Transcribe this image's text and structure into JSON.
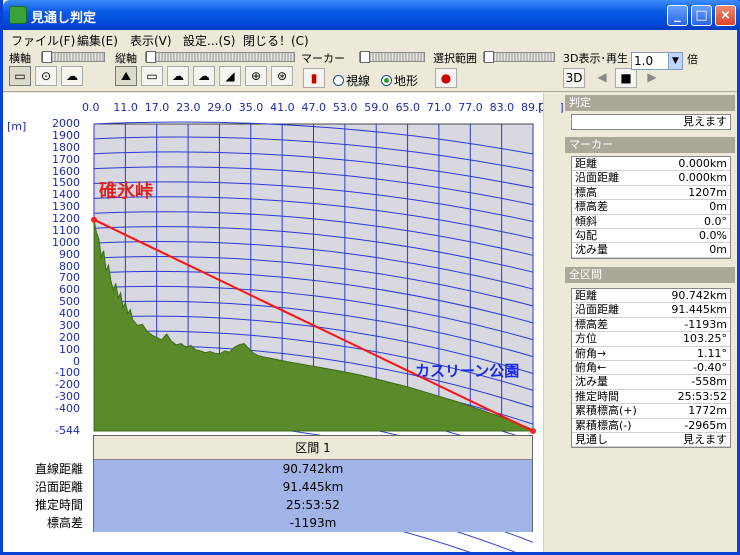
{
  "window": {
    "title": "見通し判定",
    "min": "_",
    "max": "□",
    "close": "×"
  },
  "menu": [
    "ファイル(F)",
    "編集(E)",
    "表示(V)",
    "設定...(S)",
    "閉じる！(C)"
  ],
  "toolbar": {
    "h_axis": "横軸",
    "v_axis": "縦軸",
    "marker": "マーカー",
    "range": "選択範囲",
    "view3d": "3D表示･再生",
    "zoom": "1.0",
    "times": "倍",
    "radio_sight": "視線",
    "radio_terrain": "地形",
    "radio_selected": "地形"
  },
  "chart_data": {
    "type": "area",
    "x_unit": "[km]",
    "y_unit": "[m]",
    "x_ticks": [
      "0.0",
      "11.0",
      "17.0",
      "23.0",
      "29.0",
      "35.0",
      "41.0",
      "47.0",
      "53.0",
      "59.0",
      "65.0",
      "71.0",
      "77.0",
      "83.0",
      "89.0"
    ],
    "y_ticks": [
      "2000",
      "1900",
      "1800",
      "1700",
      "1600",
      "1500",
      "1400",
      "1300",
      "1200",
      "1100",
      "1000",
      "900",
      "800",
      "700",
      "600",
      "500",
      "400",
      "300",
      "200",
      "100",
      "0",
      "-100",
      "-200",
      "-300",
      "-400",
      "-544"
    ],
    "ylim": [
      -544,
      2000
    ],
    "xlim": [
      0,
      90.742
    ],
    "terrain": [
      [
        0,
        1207
      ],
      [
        0.5,
        1100
      ],
      [
        1,
        1050
      ],
      [
        1.5,
        900
      ],
      [
        2,
        950
      ],
      [
        2.5,
        780
      ],
      [
        3,
        830
      ],
      [
        3.5,
        700
      ],
      [
        4,
        620
      ],
      [
        4.5,
        680
      ],
      [
        5,
        560
      ],
      [
        5.5,
        600
      ],
      [
        6,
        480
      ],
      [
        6.5,
        520
      ],
      [
        7,
        430
      ],
      [
        7.5,
        460
      ],
      [
        8,
        380
      ],
      [
        9,
        330
      ],
      [
        10,
        340
      ],
      [
        11,
        280
      ],
      [
        12,
        250
      ],
      [
        13,
        230
      ],
      [
        14,
        210
      ],
      [
        15,
        260
      ],
      [
        16,
        200
      ],
      [
        17,
        170
      ],
      [
        18,
        180
      ],
      [
        19,
        150
      ],
      [
        20,
        165
      ],
      [
        21,
        130
      ],
      [
        22,
        120
      ],
      [
        23,
        105
      ],
      [
        24,
        115
      ],
      [
        25,
        100
      ],
      [
        26,
        95
      ],
      [
        27,
        120
      ],
      [
        28,
        110
      ],
      [
        29,
        150
      ],
      [
        30,
        170
      ],
      [
        31,
        180
      ],
      [
        32,
        140
      ],
      [
        33,
        100
      ],
      [
        34,
        80
      ],
      [
        35,
        70
      ],
      [
        37,
        55
      ],
      [
        40,
        30
      ],
      [
        45,
        -5
      ],
      [
        50,
        -40
      ],
      [
        55,
        -80
      ],
      [
        60,
        -130
      ],
      [
        65,
        -180
      ],
      [
        70,
        -240
      ],
      [
        75,
        -300
      ],
      [
        80,
        -370
      ],
      [
        85,
        -440
      ],
      [
        90,
        -520
      ],
      [
        90.742,
        -544
      ]
    ],
    "sight_line": [
      [
        0,
        1207
      ],
      [
        90.742,
        -544
      ]
    ],
    "labels": {
      "start": "碓氷峠",
      "end": "カスリーン公園"
    }
  },
  "section": {
    "header": "区間 1",
    "labels": [
      "直線距離",
      "沿面距離",
      "推定時間",
      "標高差"
    ],
    "values": [
      "90.742km",
      "91.445km",
      "25:53:52",
      "-1193m"
    ]
  },
  "panel": {
    "judge_head": "判定",
    "judge_value": "見えます",
    "marker_head": "マーカー",
    "marker_rows": [
      [
        "距離",
        "0.000km"
      ],
      [
        "沿面距離",
        "0.000km"
      ],
      [
        "標高",
        "1207m"
      ],
      [
        "標高差",
        "0m"
      ],
      [
        "傾斜",
        "0.0°"
      ],
      [
        "勾配",
        "0.0%"
      ],
      [
        "沈み量",
        "0m"
      ]
    ],
    "all_head": "全区間",
    "all_rows": [
      [
        "距離",
        "90.742km"
      ],
      [
        "沿面距離",
        "91.445km"
      ],
      [
        "標高差",
        "-1193m"
      ],
      [
        "方位",
        "103.25°"
      ],
      [
        "俯角→",
        "1.11°"
      ],
      [
        "俯角←",
        "-0.40°"
      ],
      [
        "沈み量",
        "-558m"
      ],
      [
        "推定時間",
        "25:53:52"
      ],
      [
        "累積標高(+)",
        "1772m"
      ],
      [
        "累積標高(-)",
        "-2965m"
      ],
      [
        "見通し",
        "見えます"
      ]
    ]
  }
}
